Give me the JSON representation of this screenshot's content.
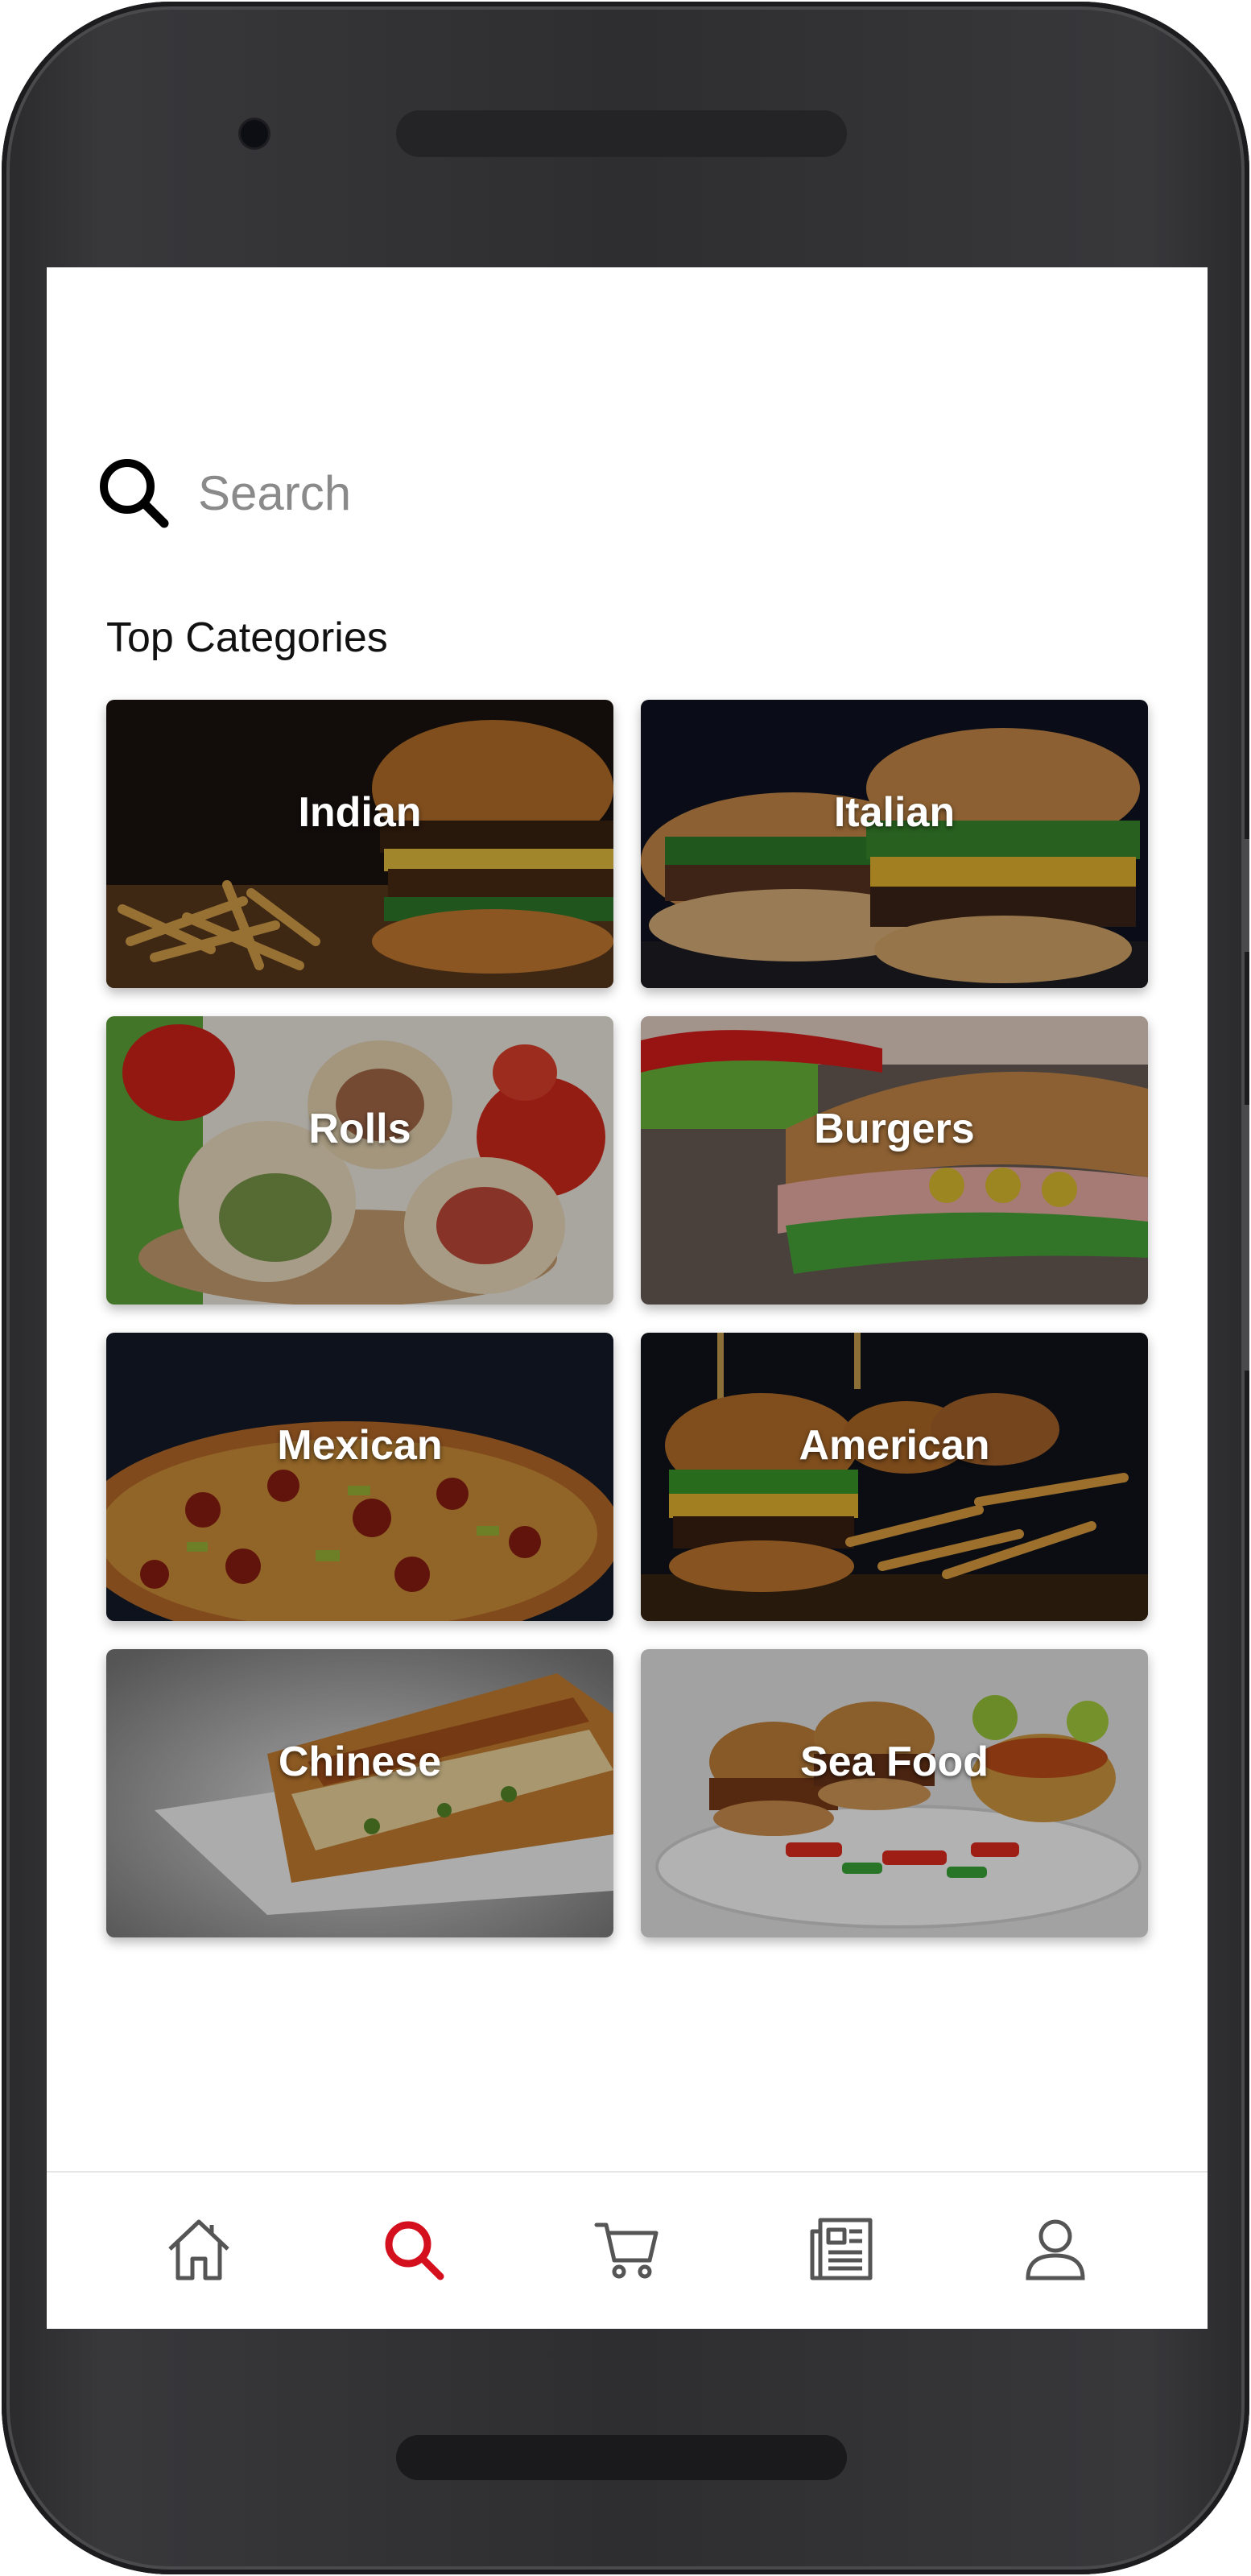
{
  "search": {
    "placeholder": "Search",
    "icon": "search-icon"
  },
  "section": {
    "title": "Top Categories"
  },
  "categories": [
    {
      "label": "Indian",
      "photo": "burger-and-fries"
    },
    {
      "label": "Italian",
      "photo": "sub-burgers"
    },
    {
      "label": "Rolls",
      "photo": "wraps"
    },
    {
      "label": "Burgers",
      "photo": "baguette-sandwich"
    },
    {
      "label": "Mexican",
      "photo": "pizza"
    },
    {
      "label": "American",
      "photo": "sliders-and-fries"
    },
    {
      "label": "Chinese",
      "photo": "lasagna"
    },
    {
      "label": "Sea Food",
      "photo": "slider-plate"
    }
  ],
  "bottom_nav": {
    "items": [
      {
        "icon": "home-icon",
        "active": false
      },
      {
        "icon": "search-icon",
        "active": true
      },
      {
        "icon": "cart-icon",
        "active": false
      },
      {
        "icon": "news-icon",
        "active": false
      },
      {
        "icon": "profile-icon",
        "active": false
      }
    ],
    "active_color": "#d40f1e",
    "inactive_color": "#555555"
  }
}
